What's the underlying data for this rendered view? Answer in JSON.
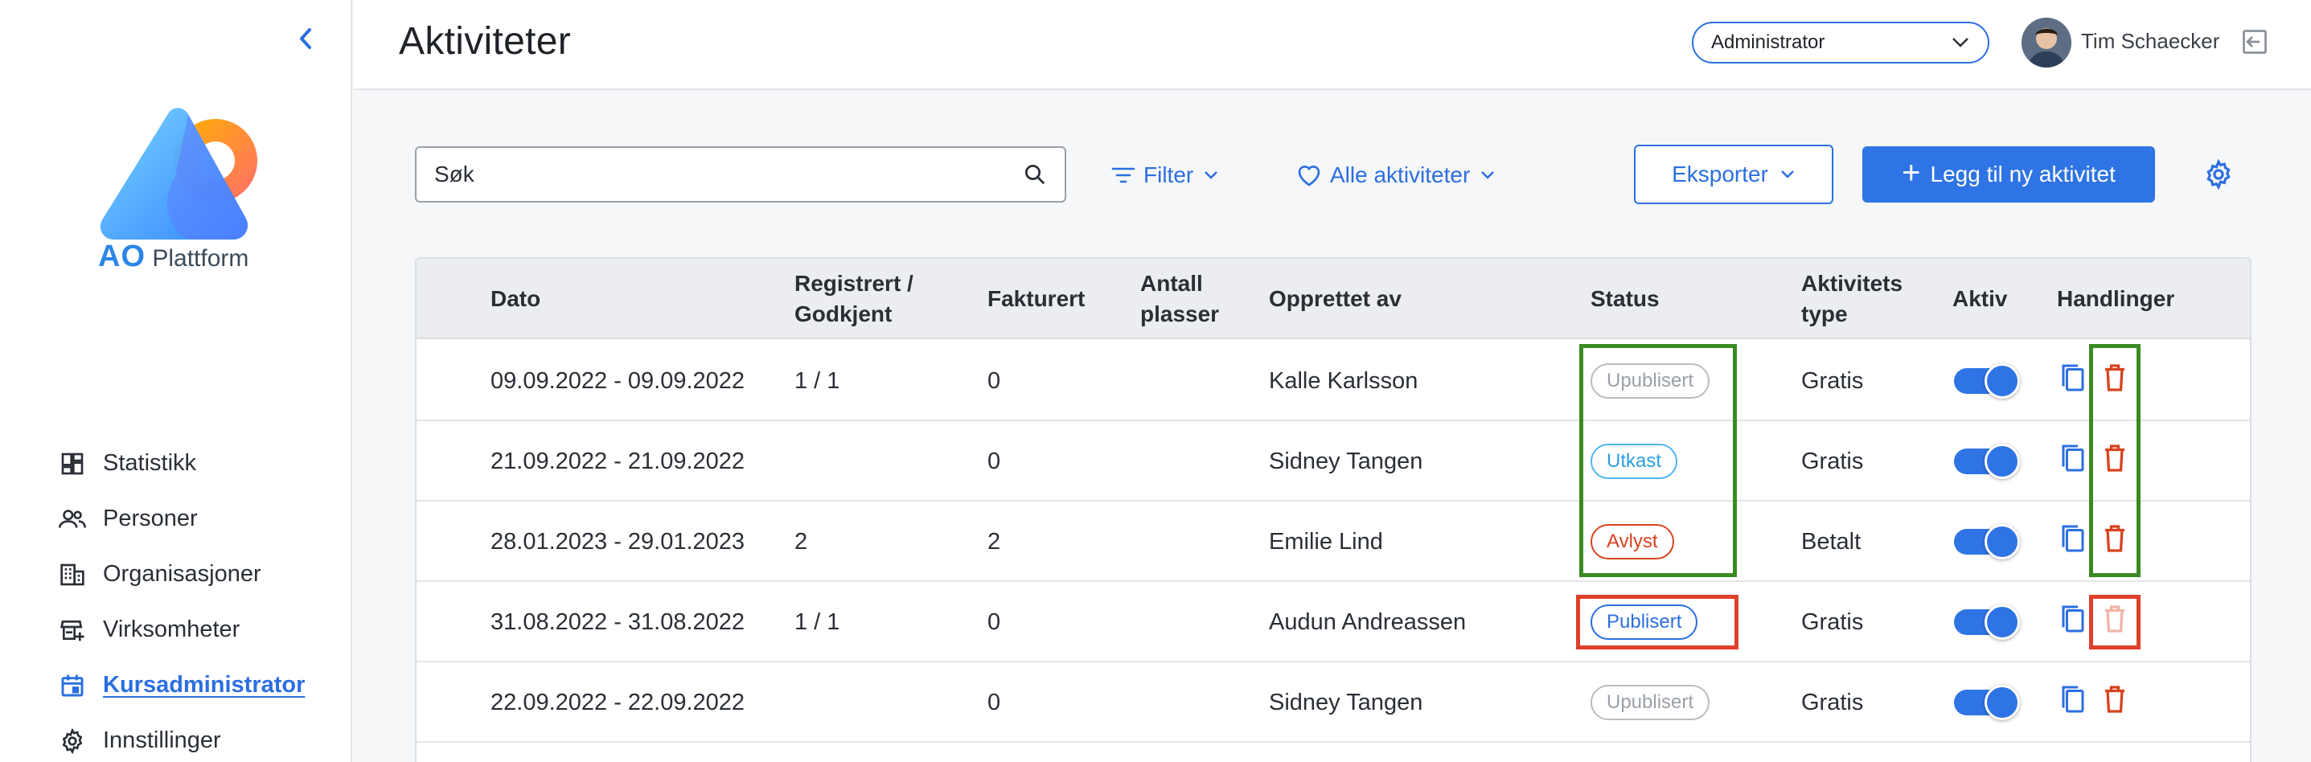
{
  "sidebar": {
    "logo_text_ao": "AO",
    "logo_text_rest": "Plattform",
    "items": [
      {
        "label": "Statistikk",
        "icon": "dashboard-icon"
      },
      {
        "label": "Personer",
        "icon": "people-icon"
      },
      {
        "label": "Organisasjoner",
        "icon": "building-icon"
      },
      {
        "label": "Virksomheter",
        "icon": "store-icon"
      },
      {
        "label": "Kursadministrator",
        "icon": "calendar-icon",
        "active": true
      },
      {
        "label": "Innstillinger",
        "icon": "gear-icon"
      }
    ]
  },
  "header": {
    "title": "Aktiviteter",
    "role_select": "Administrator",
    "user_name": "Tim Schaecker"
  },
  "toolbar": {
    "search_placeholder": "Søk",
    "filter_label": "Filter",
    "favorites_label": "Alle aktiviteter",
    "export_label": "Eksporter",
    "add_label": "Legg til ny aktivitet"
  },
  "table": {
    "columns": [
      "Dato",
      "Registrert / Godkjent",
      "Fakturert",
      "Antall plasser",
      "Opprettet av",
      "Status",
      "Aktivitets type",
      "Aktiv",
      "Handlinger"
    ],
    "rows": [
      {
        "date": "09.09.2022 - 09.09.2022",
        "registered": "1 / 1",
        "invoiced": "0",
        "seats": "",
        "created_by": "Kalle Karlsson",
        "status": "Upublisert",
        "status_key": "upublisert",
        "type": "Gratis",
        "active": true
      },
      {
        "date": "21.09.2022 - 21.09.2022",
        "registered": "",
        "invoiced": "0",
        "seats": "",
        "created_by": "Sidney Tangen",
        "status": "Utkast",
        "status_key": "utkast",
        "type": "Gratis",
        "active": true
      },
      {
        "date": "28.01.2023 - 29.01.2023",
        "registered": "2",
        "invoiced": "2",
        "seats": "",
        "created_by": "Emilie Lind",
        "status": "Avlyst",
        "status_key": "avlyst",
        "type": "Betalt",
        "active": true
      },
      {
        "date": "31.08.2022 - 31.08.2022",
        "registered": "1 / 1",
        "invoiced": "0",
        "seats": "",
        "created_by": "Audun Andreassen",
        "status": "Publisert",
        "status_key": "publisert",
        "type": "Gratis",
        "active": true,
        "delete_disabled": true
      },
      {
        "date": "22.09.2022 - 22.09.2022",
        "registered": "",
        "invoiced": "0",
        "seats": "",
        "created_by": "Sidney Tangen",
        "status": "Upublisert",
        "status_key": "upublisert",
        "type": "Gratis",
        "active": true
      }
    ]
  },
  "colors": {
    "accent": "#2f74e4",
    "danger": "#d8431f",
    "highlight_green": "#3a8a22",
    "highlight_red": "#e0402a"
  }
}
